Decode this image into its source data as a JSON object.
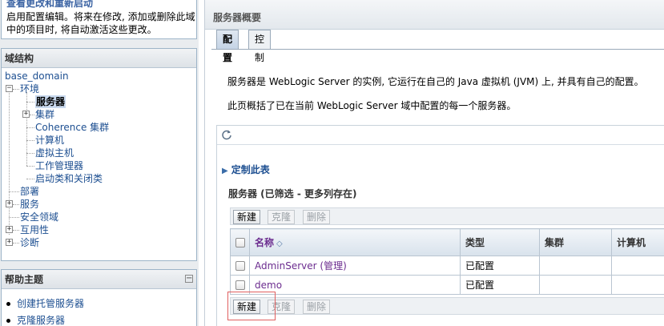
{
  "change_center": {
    "cut_title": "查看更改和重新启动",
    "text": "启用配置编辑。将来在修改, 添加或删除此域中的项目时, 将自动激活这些更改。"
  },
  "domain_structure": {
    "title": "域结构",
    "root": "base_domain",
    "tree": [
      {
        "label": "环境",
        "level": 0,
        "toggle": "−"
      },
      {
        "label": "服务器",
        "level": 1,
        "selected": true
      },
      {
        "label": "集群",
        "level": 1,
        "toggle": "+"
      },
      {
        "label": "Coherence 集群",
        "level": 1
      },
      {
        "label": "计算机",
        "level": 1
      },
      {
        "label": "虚拟主机",
        "level": 1
      },
      {
        "label": "工作管理器",
        "level": 1
      },
      {
        "label": "启动类和关闭类",
        "level": 1
      },
      {
        "label": "部署",
        "level": 0
      },
      {
        "label": "服务",
        "level": 0,
        "toggle": "+"
      },
      {
        "label": "安全领域",
        "level": 0
      },
      {
        "label": "互用性",
        "level": 0,
        "toggle": "+"
      },
      {
        "label": "诊断",
        "level": 0,
        "toggle": "+"
      }
    ]
  },
  "help": {
    "title": "帮助主题",
    "minimize_symbol": "−",
    "items": [
      "创建托管服务器",
      "克隆服务器"
    ]
  },
  "main": {
    "title": "服务器概要",
    "tabs": [
      "配置",
      "控制"
    ],
    "active_tab": "配置",
    "intro1": "服务器是 WebLogic Server 的实例, 它运行在自己的 Java 虚拟机 (JVM) 上, 并具有自己的配置。",
    "intro2": "此页概括了已在当前 WebLogic Server 域中配置的每一个服务器。",
    "customize": "定制此表",
    "table_title": "服务器 (已筛选 - 更多列存在)",
    "buttons": {
      "new": "新建",
      "clone": "克隆",
      "delete": "删除"
    },
    "columns": [
      "名称",
      "类型",
      "集群",
      "计算机"
    ],
    "rows": [
      {
        "name": "AdminServer (管理)",
        "type": "已配置",
        "cluster": "",
        "machine": ""
      },
      {
        "name": "demo",
        "type": "已配置",
        "cluster": "",
        "machine": ""
      }
    ]
  },
  "icons": {
    "refresh": "refresh-icon",
    "expand": "plus-icon",
    "collapse": "minus-icon",
    "sort": "sort-ascending-icon",
    "disclosure": "triangle-right-icon"
  },
  "colors": {
    "link": "#1d4f91",
    "visited_link": "#6b2c8f",
    "panel_border": "#9db4c8",
    "highlight_border": "#e06060"
  }
}
